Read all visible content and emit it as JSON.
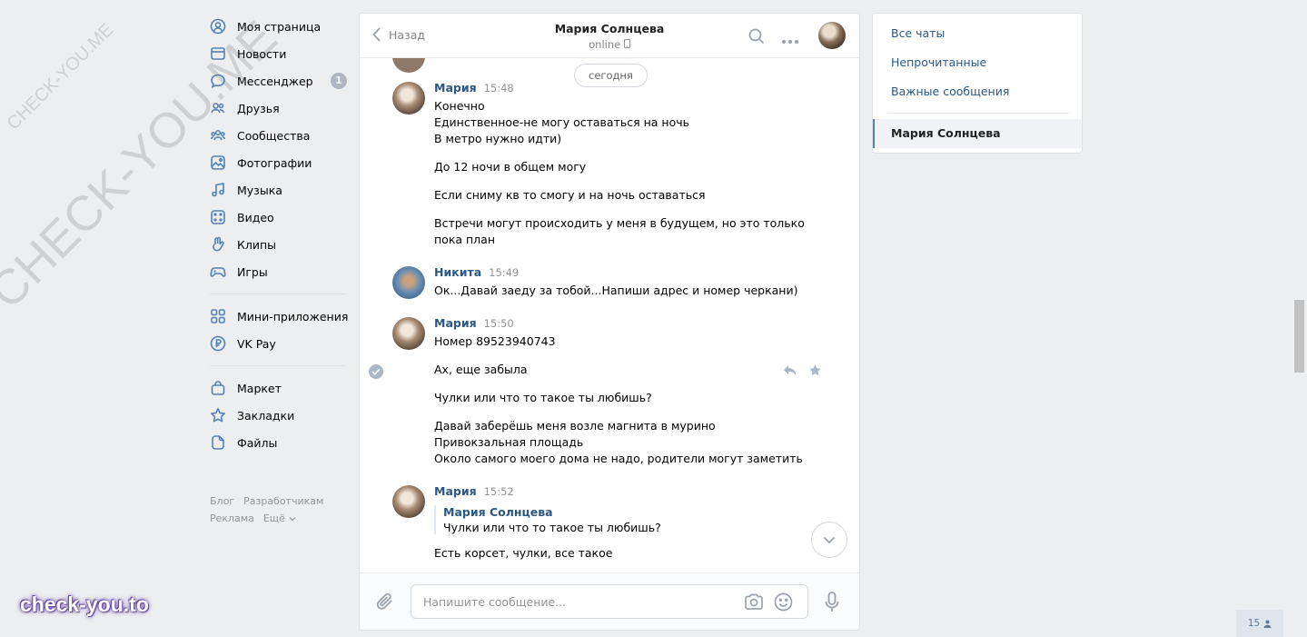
{
  "watermark": {
    "small": "CHECK-YOU.ME",
    "big": "CHECK-YOU.ME",
    "brand": "check-you.to"
  },
  "nav": {
    "items": [
      {
        "label": "Моя страница",
        "icon": "user-circle-icon"
      },
      {
        "label": "Новости",
        "icon": "news-icon"
      },
      {
        "label": "Мессенджер",
        "icon": "message-icon",
        "badge": "1"
      },
      {
        "label": "Друзья",
        "icon": "friends-icon"
      },
      {
        "label": "Сообщества",
        "icon": "communities-icon"
      },
      {
        "label": "Фотографии",
        "icon": "photo-icon"
      },
      {
        "label": "Музыка",
        "icon": "music-icon"
      },
      {
        "label": "Видео",
        "icon": "video-icon"
      },
      {
        "label": "Клипы",
        "icon": "clips-icon"
      },
      {
        "label": "Игры",
        "icon": "gamepad-icon"
      }
    ],
    "items2": [
      {
        "label": "Мини-приложения",
        "icon": "apps-icon"
      },
      {
        "label": "VK Pay",
        "icon": "vkpay-icon"
      }
    ],
    "items3": [
      {
        "label": "Маркет",
        "icon": "market-icon"
      },
      {
        "label": "Закладки",
        "icon": "star-icon"
      },
      {
        "label": "Файлы",
        "icon": "file-icon"
      }
    ],
    "footer": {
      "blog": "Блог",
      "devs": "Разработчикам",
      "ads": "Реклама",
      "more": "Ещё"
    }
  },
  "chat": {
    "back_label": "Назад",
    "peer_name": "Мария Солнцева",
    "peer_status": "online",
    "date_divider": "сегодня",
    "messages": [
      {
        "author": "Мария",
        "time": "15:48",
        "lines": [
          "Конечно",
          "Единственное-не могу оставаться на ночь",
          "В метро нужно идти)",
          "До 12 ночи в общем могу",
          "Если сниму кв то смогу и на ночь оставаться",
          "Встречи могут происходить у меня в будущем, но это только",
          "пока план"
        ]
      },
      {
        "author": "Никита",
        "time": "15:49",
        "lines": [
          "Ок...Давай заеду за тобой...Напиши адрес и номер черкани)"
        ]
      },
      {
        "author": "Мария",
        "time": "15:50",
        "lines": [
          "Номер 89523940743",
          "Ах, еще забыла",
          "Чулки или что то такое ты любишь?",
          "Давай заберёшь меня возле магнита в мурино",
          "Привокзальная площадь",
          "Около самого моего дома не надо, родители могут заметить"
        ]
      },
      {
        "author": "Мария",
        "time": "15:52",
        "forward_author": "Мария Солнцева",
        "forward_text": "Чулки или что то такое ты любишь?",
        "lines": [
          "Есть корсет, чулки, все такое"
        ]
      }
    ],
    "composer_placeholder": "Напишите сообщение..."
  },
  "right_panel": {
    "all_chats": "Все чаты",
    "unread": "Непрочитанные",
    "important": "Важные сообщения",
    "active_chat": "Мария Солнцева"
  },
  "online_count": "15",
  "colors": {
    "link": "#2a5885",
    "accent": "#5181b8",
    "background": "#edeef0"
  }
}
